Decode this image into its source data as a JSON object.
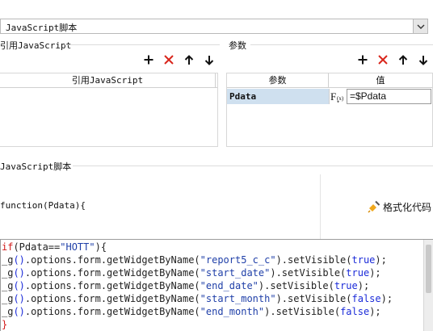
{
  "script_type": {
    "selected": "JavaScript脚本"
  },
  "references": {
    "title": "引用JavaScript",
    "column_header": "引用JavaScript",
    "toolbar": [
      "add",
      "delete",
      "move-up",
      "move-down"
    ]
  },
  "params": {
    "title": "参数",
    "col_param": "参数",
    "col_value": "值",
    "rows": [
      {
        "name": "Pdata",
        "fx_label": "F(x)",
        "value": "=$Pdata"
      }
    ],
    "toolbar": [
      "add",
      "delete",
      "move-up",
      "move-down"
    ]
  },
  "script": {
    "title": "JavaScript脚本",
    "signature": "function(Pdata){",
    "format_button": "格式化代码",
    "code": [
      [
        [
          "r",
          "if"
        ],
        [
          "m",
          "(Pdata=="
        ],
        [
          "s",
          "\"HOTT\""
        ],
        [
          "m",
          "){"
        ]
      ],
      [
        [
          "m",
          "_g"
        ],
        [
          "b",
          "()"
        ],
        [
          "m",
          ".options.form.getWidgetByName("
        ],
        [
          "s",
          "\"report5_c_c\""
        ],
        [
          "m",
          ").setVisible("
        ],
        [
          "b",
          "true"
        ],
        [
          "m",
          ");"
        ]
      ],
      [
        [
          "m",
          "_g"
        ],
        [
          "b",
          "()"
        ],
        [
          "m",
          ".options.form.getWidgetByName("
        ],
        [
          "s",
          "\"start_date\""
        ],
        [
          "m",
          ").setVisible("
        ],
        [
          "b",
          "true"
        ],
        [
          "m",
          ");"
        ]
      ],
      [
        [
          "m",
          "_g"
        ],
        [
          "b",
          "()"
        ],
        [
          "m",
          ".options.form.getWidgetByName("
        ],
        [
          "s",
          "\"end_date\""
        ],
        [
          "m",
          ").setVisible("
        ],
        [
          "b",
          "true"
        ],
        [
          "m",
          ");"
        ]
      ],
      [
        [
          "m",
          "_g"
        ],
        [
          "b",
          "()"
        ],
        [
          "m",
          ".options.form.getWidgetByName("
        ],
        [
          "s",
          "\"start_month\""
        ],
        [
          "m",
          ").setVisible("
        ],
        [
          "b",
          "false"
        ],
        [
          "m",
          ");"
        ]
      ],
      [
        [
          "m",
          "_g"
        ],
        [
          "b",
          "()"
        ],
        [
          "m",
          ".options.form.getWidgetByName("
        ],
        [
          "s",
          "\"end_month\""
        ],
        [
          "m",
          ").setVisible("
        ],
        [
          "b",
          "false"
        ],
        [
          "m",
          ");"
        ]
      ],
      [
        [
          "r",
          "}"
        ]
      ]
    ]
  },
  "colors": {
    "selected_row": "#cfe0ef",
    "delete_icon": "#d9261c"
  }
}
